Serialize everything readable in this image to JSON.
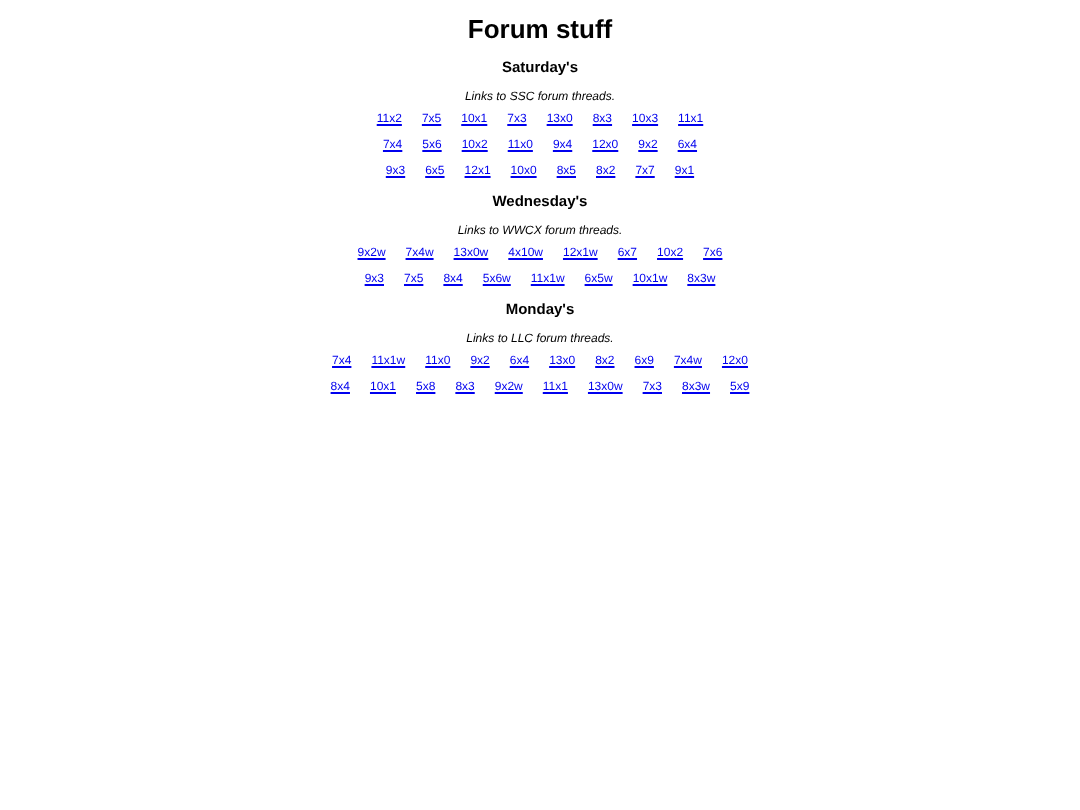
{
  "title": "Forum stuff",
  "sections": [
    {
      "heading": "Saturday's",
      "caption": "Links to SSC forum threads.",
      "rows": [
        [
          "11x2",
          "7x5",
          "10x1",
          "7x3",
          "13x0",
          "8x3",
          "10x3",
          "11x1"
        ],
        [
          "7x4",
          "5x6",
          "10x2",
          "11x0",
          "9x4",
          "12x0",
          "9x2",
          "6x4"
        ],
        [
          "9x3",
          "6x5",
          "12x1",
          "10x0",
          "8x5",
          "8x2",
          "7x7",
          "9x1"
        ]
      ]
    },
    {
      "heading": "Wednesday's",
      "caption": "Links to WWCX forum threads.",
      "rows": [
        [
          "9x2w",
          "7x4w",
          "13x0w",
          "4x10w",
          "12x1w",
          "6x7",
          "10x2",
          "7x6"
        ],
        [
          "9x3",
          "7x5",
          "8x4",
          "5x6w",
          "11x1w",
          "6x5w",
          "10x1w",
          "8x3w"
        ]
      ]
    },
    {
      "heading": "Monday's",
      "caption": "Links to LLC forum threads.",
      "rows": [
        [
          "7x4",
          "11x1w",
          "11x0",
          "9x2",
          "6x4",
          "13x0",
          "8x2",
          "6x9",
          "7x4w",
          "12x0"
        ],
        [
          "8x4",
          "10x1",
          "5x8",
          "8x3",
          "9x2w",
          "11x1",
          "13x0w",
          "7x3",
          "8x3w",
          "5x9"
        ]
      ]
    }
  ]
}
